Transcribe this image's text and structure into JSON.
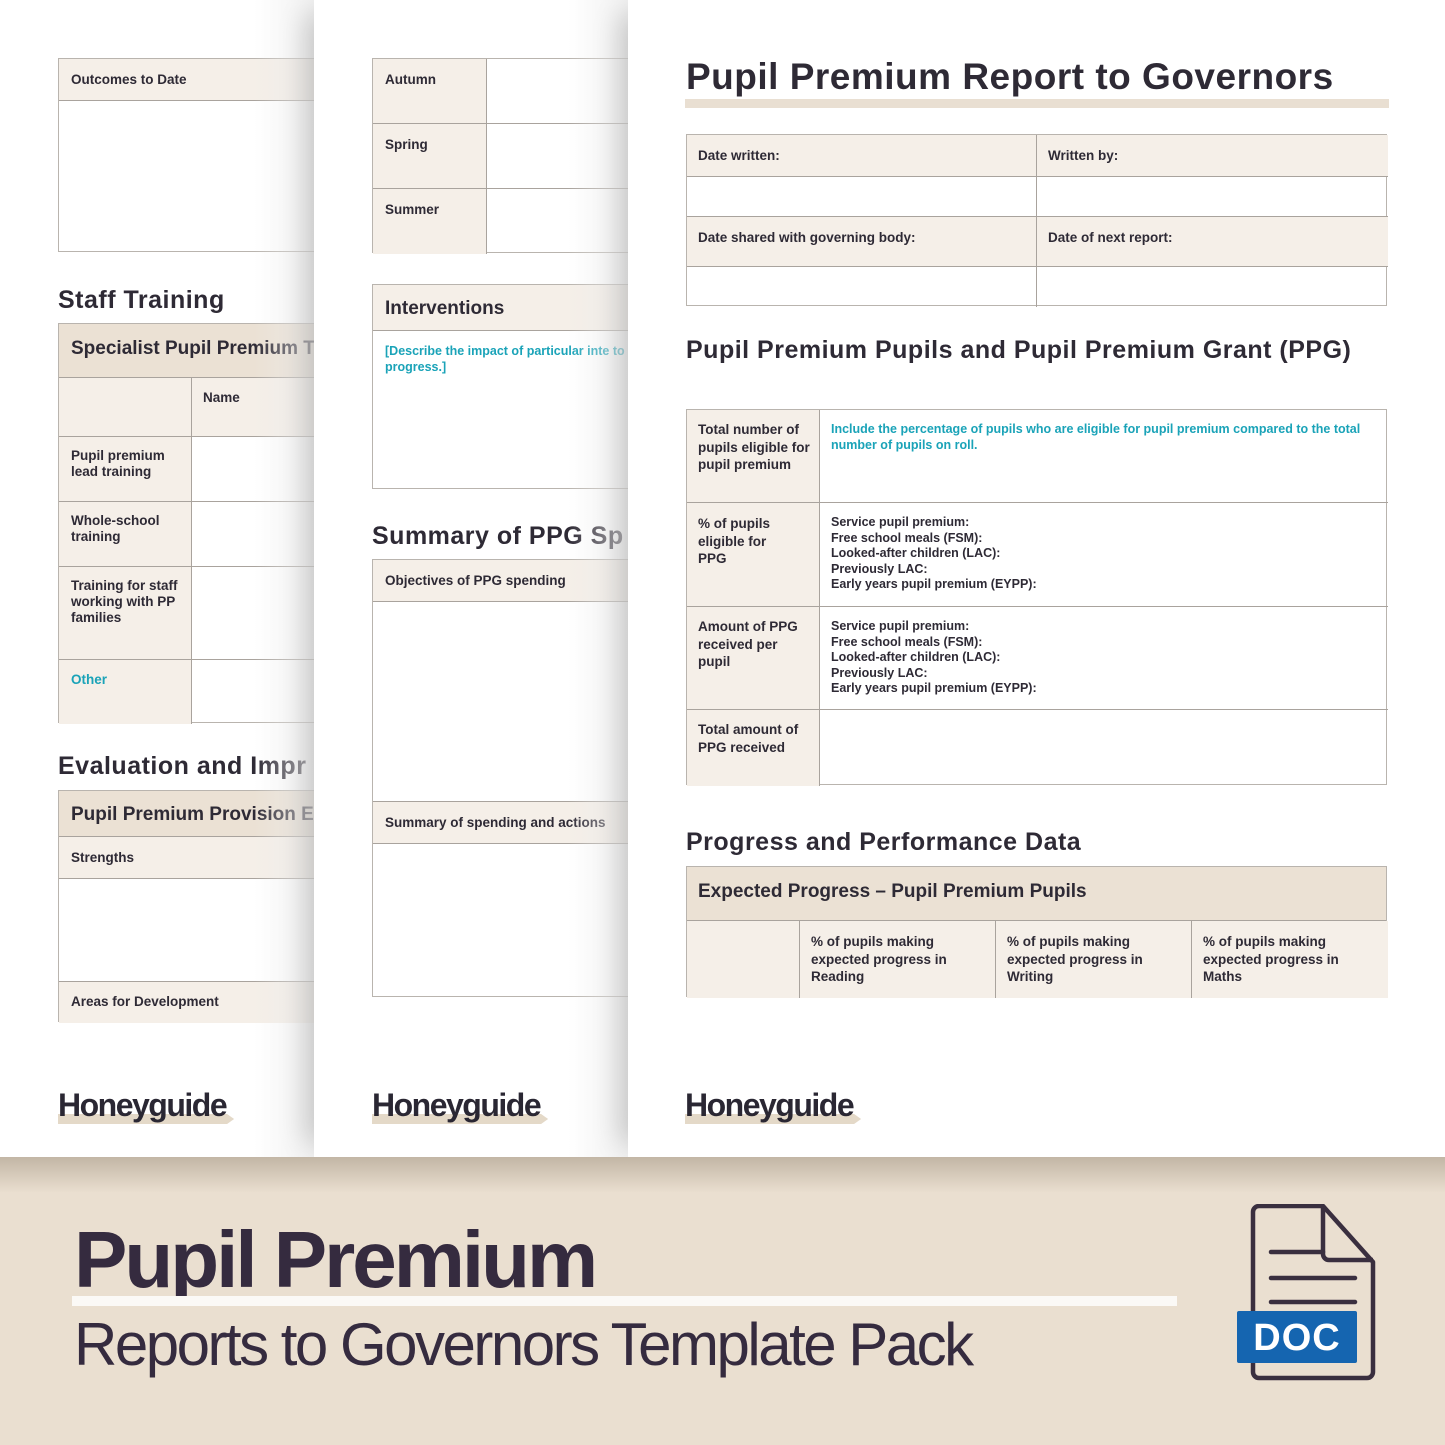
{
  "page1": {
    "outcomes_header": "Outcomes to Date",
    "staff_training_title": "Staff Training",
    "specialist_header": "Specialist Pupil Premium T",
    "name_col": "Name",
    "rows": [
      "Pupil premium lead training",
      "Whole-school training",
      "Training for staff working with PP families",
      "Other"
    ],
    "evaluation_title": "Evaluation and Impr",
    "provision_header": "Pupil Premium Provision E",
    "strengths": "Strengths",
    "areas": "Areas for Development",
    "logo": "Honeyguide"
  },
  "page2": {
    "terms": [
      "Autumn",
      "Spring",
      "Summer"
    ],
    "interventions_header": "Interventions",
    "interventions_hint": "[Describe the impact of particular inte to progress.]",
    "summary_title": "Summary of PPG Sp",
    "objectives_header": "Objectives of PPG spending",
    "summary_actions_header": "Summary of spending and actions",
    "logo": "Honeyguide"
  },
  "page3": {
    "title": "Pupil Premium Report to Governors",
    "info": {
      "date_written": "Date written:",
      "written_by": "Written by:",
      "date_shared": "Date shared with governing body:",
      "date_next": "Date of next report:"
    },
    "ppg_title": "Pupil Premium Pupils and Pupil Premium Grant (PPG)",
    "ppg_rows": [
      {
        "label": "Total number of pupils eligible for pupil premium",
        "hint": "Include the percentage of pupils who are eligible for pupil premium compared to the total number of pupils on roll."
      },
      {
        "label": "% of pupils eligible for PPG",
        "lines": [
          "Service pupil premium:",
          "Free school meals (FSM):",
          "Looked-after children (LAC):",
          "Previously LAC:",
          "Early years pupil premium (EYPP):"
        ]
      },
      {
        "label": "Amount of PPG received per pupil",
        "lines": [
          "Service pupil premium:",
          "Free school meals (FSM):",
          "Looked-after children (LAC):",
          "Previously LAC:",
          "Early years pupil premium (EYPP):"
        ]
      },
      {
        "label": "Total amount of PPG received"
      }
    ],
    "progress_title": "Progress and Performance Data",
    "expected_header": "Expected Progress – Pupil Premium Pupils",
    "progress_cols": [
      "% of pupils making expected progress in Reading",
      "% of pupils making expected progress in Writing",
      "% of pupils making expected progress in Maths"
    ],
    "logo": "Honeyguide"
  },
  "banner": {
    "title": "Pupil Premium",
    "subtitle": "Reports to Governors Template Pack",
    "file_type": "DOC"
  },
  "colors": {
    "ink": "#2e2a35",
    "beige_light": "#f5efe8",
    "beige_dark": "#ebe1d4",
    "teal": "#1aa3b8",
    "banner_bg": "#eadfd0",
    "doc_blue": "#1565b0"
  }
}
